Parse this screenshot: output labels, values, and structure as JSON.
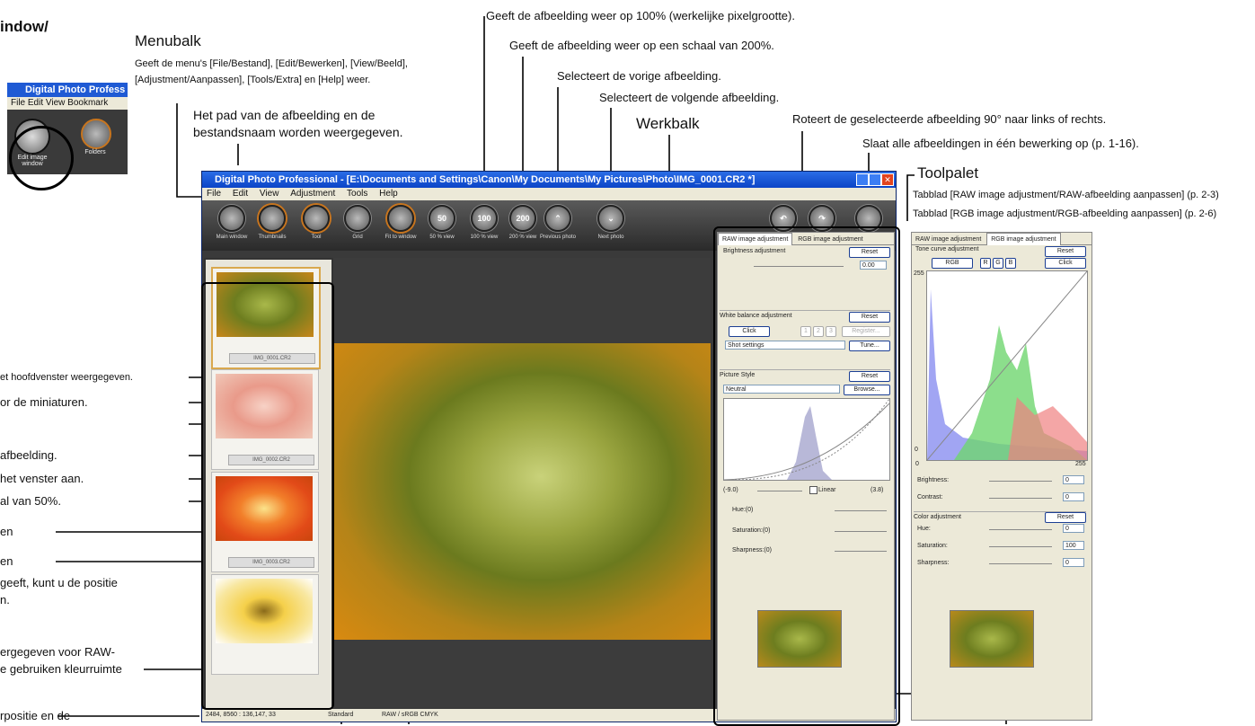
{
  "heading_fragment": "indow/",
  "dpp_window": {
    "title": "Digital Photo Professional - [E:\\Documents and Settings\\Canon\\My Documents\\My Pictures\\Photo\\IMG_0001.CR2 *]",
    "menus": [
      "File",
      "Edit",
      "View",
      "Adjustment",
      "Tools",
      "Help"
    ],
    "toolbar_buttons": [
      {
        "label": "Main window",
        "icon": "main-window-icon",
        "glyph": ""
      },
      {
        "label": "Thumbnails",
        "icon": "thumbnails-icon",
        "glyph": ""
      },
      {
        "label": "Tool",
        "icon": "tool-icon",
        "glyph": ""
      },
      {
        "label": "Grid",
        "icon": "grid-icon",
        "glyph": ""
      },
      {
        "label": "Fit to window",
        "icon": "fit-to-window-icon",
        "glyph": ""
      },
      {
        "label": "50 % view",
        "icon": "50-view-icon",
        "glyph": "50"
      },
      {
        "label": "100 % view",
        "icon": "100-view-icon",
        "glyph": "100"
      },
      {
        "label": "200 % view",
        "icon": "200-view-icon",
        "glyph": "200"
      },
      {
        "label": "Previous photo",
        "icon": "previous-photo-icon",
        "glyph": "⌃"
      },
      {
        "label": "Next photo",
        "icon": "next-photo-icon",
        "glyph": "⌄"
      },
      {
        "label": "Rotate left",
        "icon": "rotate-left-icon",
        "glyph": "↶"
      },
      {
        "label": "Rotate right",
        "icon": "rotate-right-icon",
        "glyph": "↷"
      },
      {
        "label": "Batch",
        "icon": "batch-icon",
        "glyph": ""
      }
    ],
    "thumbnails": [
      "IMG_0001.CR2",
      "IMG_0002.CR2",
      "IMG_0003.CR2"
    ],
    "status": {
      "coords": "2484, 8560 : 136,147, 33",
      "style": "Standard",
      "color": "RAW / sRGB  CMYK"
    }
  },
  "mini_window": {
    "title": "Digital Photo Profess",
    "menus": "File  Edit  View  Bookmark",
    "edit_button": "Edit image window",
    "folders_button": "Folders"
  },
  "raw_palette": {
    "tab_raw": "RAW image adjustment",
    "tab_rgb": "RGB image adjustment",
    "brightness": "Brightness adjustment",
    "reset": "Reset",
    "brightness_value": "0.00",
    "white_balance": "White balance adjustment",
    "click": "Click",
    "wb_1": "1",
    "wb_2": "2",
    "wb_3": "3",
    "register": "Register...",
    "shot_settings": "Shot settings",
    "tune": "Tune...",
    "picture_style": "Picture Style",
    "neutral": "Neutral",
    "browse": "Browse...",
    "range_min": "(-9.0)",
    "linear": "Linear",
    "range_max": "(3.8)",
    "hue": "Hue:(0)",
    "saturation": "Saturation:(0)",
    "sharpness": "Sharpness:(0)"
  },
  "rgb_palette": {
    "tab_raw": "RAW image adjustment",
    "tab_rgb": "RGB image adjustment",
    "tone_curve": "Tone curve adjustment",
    "reset": "Reset",
    "rgb": "RGB",
    "r": "R",
    "g": "G",
    "b": "B",
    "click": "Click",
    "axis_top": "255",
    "axis_zero_left": "0",
    "axis_zero_bottom": "0",
    "axis_right": "255",
    "brightness": "Brightness:",
    "brightness_val": "0",
    "contrast": "Contrast:",
    "contrast_val": "0",
    "color_adj": "Color adjustment",
    "hue": "Hue:",
    "hue_val": "0",
    "saturation": "Saturation:",
    "saturation_val": "100",
    "sharpness": "Sharpness:",
    "sharpness_val": "0"
  },
  "callouts": {
    "menubalk_title": "Menubalk",
    "menubalk_desc1": "Geeft de menu's [File/Bestand], [Edit/Bewerken], [View/Beeld],",
    "menubalk_desc2": "[Adjustment/Aanpassen], [Tools/Extra] en [Help] weer.",
    "path1": "Het pad van de afbeelding en de",
    "path2": "bestandsnaam worden weergegeven.",
    "view100": "Geeft de afbeelding weer op 100% (werkelijke pixelgrootte).",
    "view200": "Geeft de afbeelding weer op een schaal van 200%.",
    "previous": "Selecteert de vorige afbeelding.",
    "next": "Selecteert de volgende afbeelding.",
    "werkbalk": "Werkbalk",
    "rotate": "Roteert de geselecteerde afbeelding 90° naar links of rechts.",
    "batch": "Slaat alle afbeeldingen in één bewerking op (p. 1-16).",
    "toolpalet": "Toolpalet",
    "tab_raw_ref": "Tabblad [RAW image adjustment/RAW-afbeelding aanpassen] (p. 2-3)",
    "tab_rgb_ref": "Tabblad [RGB image adjustment/RGB-afbeelding aanpassen] (p. 2-6)",
    "left1": "et hoofdvenster weergegeven.",
    "left2": "or de miniaturen.",
    "left3": "afbeelding.",
    "left4": "het venster aan.",
    "left5": "al van 50%.",
    "left6": "en",
    "left7": "en",
    "left8": "geeft, kunt u de positie",
    "left9": "n.",
    "left10": "ergegeven voor RAW-",
    "left11": "e gebruiken kleurruimte",
    "left12": "rpositie en de"
  }
}
